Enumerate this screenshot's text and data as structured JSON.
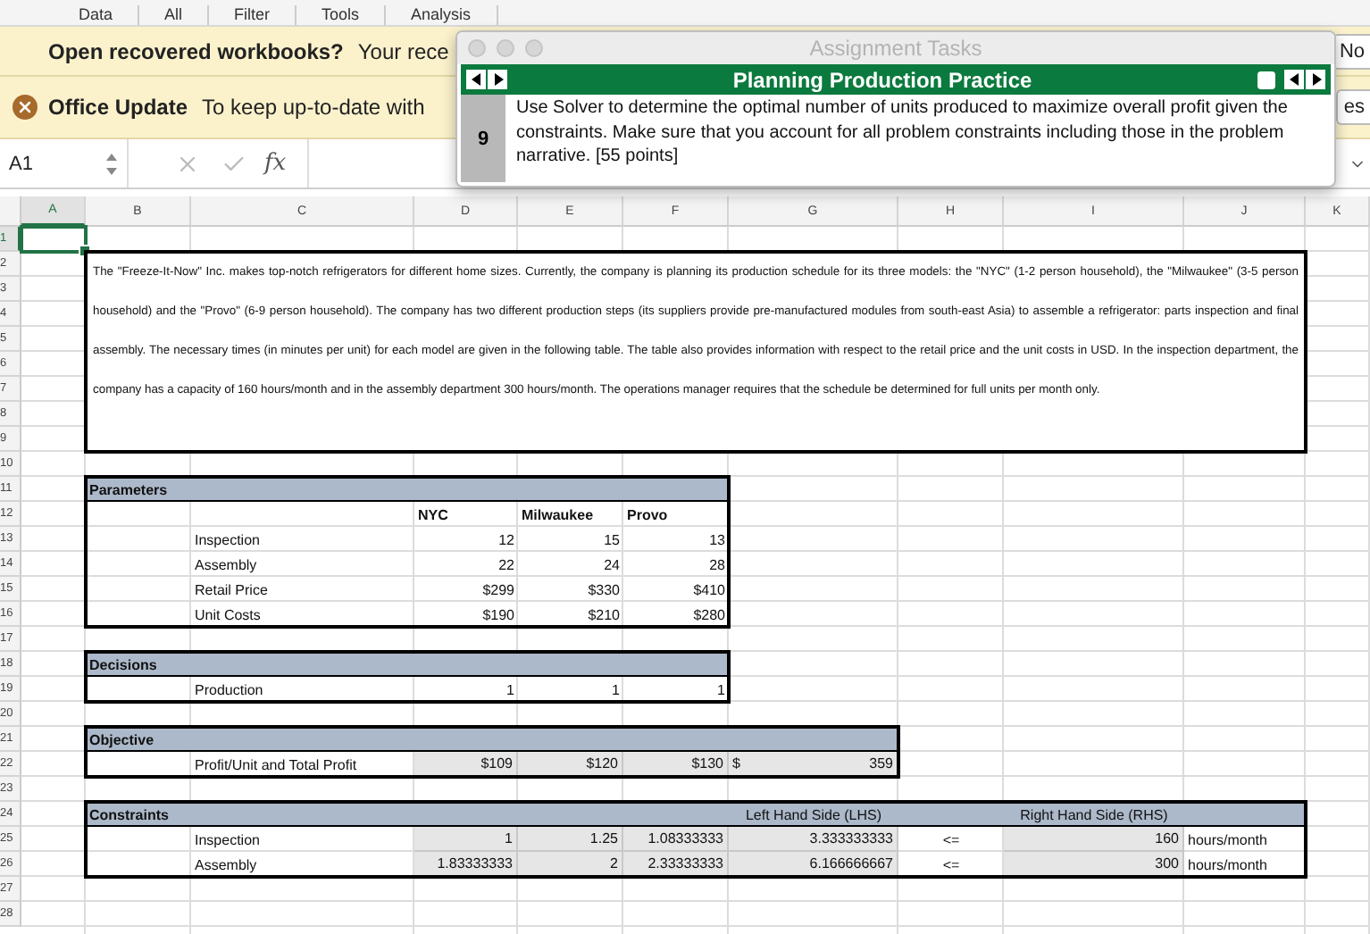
{
  "toolbar": {
    "items": [
      "Data",
      "All",
      "Filter",
      "Tools",
      "Analysis"
    ]
  },
  "notifications": [
    {
      "kind": "recovery",
      "title": "Open recovered workbooks?",
      "message": "Your rece",
      "button": "No"
    },
    {
      "kind": "update",
      "title": "Office Update",
      "message": "To keep up-to-date with",
      "button": "es"
    }
  ],
  "formula_bar": {
    "name_box": "A1",
    "function_label": "fx"
  },
  "task_pane": {
    "window_title": "Assignment Tasks",
    "header": "Planning Production Practice",
    "checked": false,
    "task_number": "9",
    "task_text": "Use Solver to determine the optimal number of units produced to maximize overall profit given the constraints. Make sure that you account for all problem constraints including those in the problem narrative. [55 points]"
  },
  "sheet": {
    "column_headers": [
      {
        "label": "A",
        "selected": true
      },
      {
        "label": "B",
        "selected": false
      },
      {
        "label": "C",
        "selected": false
      },
      {
        "label": "D",
        "selected": false
      },
      {
        "label": "E",
        "selected": false
      },
      {
        "label": "F",
        "selected": false
      },
      {
        "label": "G",
        "selected": false
      },
      {
        "label": "H",
        "selected": false
      },
      {
        "label": "I",
        "selected": false
      },
      {
        "label": "J",
        "selected": false
      },
      {
        "label": "K",
        "selected": false
      }
    ],
    "row_numbers": [
      {
        "label": "1",
        "selected": true
      },
      {
        "label": "2",
        "selected": false
      },
      {
        "label": "3",
        "selected": false
      },
      {
        "label": "4",
        "selected": false
      },
      {
        "label": "5",
        "selected": false
      },
      {
        "label": "6",
        "selected": false
      },
      {
        "label": "7",
        "selected": false
      },
      {
        "label": "8",
        "selected": false
      },
      {
        "label": "9",
        "selected": false
      },
      {
        "label": "10",
        "selected": false
      },
      {
        "label": "11",
        "selected": false
      },
      {
        "label": "12",
        "selected": false
      },
      {
        "label": "13",
        "selected": false
      },
      {
        "label": "14",
        "selected": false
      },
      {
        "label": "15",
        "selected": false
      },
      {
        "label": "16",
        "selected": false
      },
      {
        "label": "17",
        "selected": false
      },
      {
        "label": "18",
        "selected": false
      },
      {
        "label": "19",
        "selected": false
      },
      {
        "label": "20",
        "selected": false
      },
      {
        "label": "21",
        "selected": false
      },
      {
        "label": "22",
        "selected": false
      },
      {
        "label": "23",
        "selected": false
      },
      {
        "label": "24",
        "selected": false
      },
      {
        "label": "25",
        "selected": false
      },
      {
        "label": "26",
        "selected": false
      },
      {
        "label": "27",
        "selected": false
      },
      {
        "label": "28",
        "selected": false
      }
    ],
    "paragraph": "The \"Freeze-It-Now\" Inc. makes top-notch refrigerators for different home sizes. Currently, the company is planning its production schedule for its three models: the \"NYC\" (1-2 person household), the \"Milwaukee\" (3-5 person household) and the \"Provo\" (6-9 person household). The company has two different production steps (its suppliers provide pre-manufactured modules from south-east Asia) to assemble a refrigerator: parts inspection and final assembly. The necessary times (in minutes per unit) for each model are given in the following table. The table also provides information with respect to the retail price and the unit costs in USD. In the inspection department, the company has a capacity of 160 hours/month and in the assembly department 300 hours/month. The operations manager requires that the schedule be determined for full units per month only.",
    "tables": [
      {
        "title": "Parameters",
        "column_labels": [
          "NYC",
          "Milwaukee",
          "Provo"
        ],
        "rows": [
          {
            "label": "Inspection",
            "values": [
              {
                "text": "12",
                "shaded": false
              },
              {
                "text": "15",
                "shaded": false
              },
              {
                "text": "13",
                "shaded": false
              }
            ]
          },
          {
            "label": "Assembly",
            "values": [
              {
                "text": "22",
                "shaded": false
              },
              {
                "text": "24",
                "shaded": false
              },
              {
                "text": "28",
                "shaded": false
              }
            ]
          },
          {
            "label": "Retail Price",
            "values": [
              {
                "text": "$299",
                "shaded": false
              },
              {
                "text": "$330",
                "shaded": false
              },
              {
                "text": "$410",
                "shaded": false
              }
            ]
          },
          {
            "label": "Unit Costs",
            "values": [
              {
                "text": "$190",
                "shaded": false
              },
              {
                "text": "$210",
                "shaded": false
              },
              {
                "text": "$280",
                "shaded": false
              }
            ]
          }
        ]
      },
      {
        "title": "Decisions",
        "rows": [
          {
            "label": "Production",
            "values": [
              {
                "text": "1",
                "shaded": false
              },
              {
                "text": "1",
                "shaded": false
              },
              {
                "text": "1",
                "shaded": false
              }
            ]
          }
        ]
      },
      {
        "title": "Objective",
        "rows": [
          {
            "label": "Profit/Unit and Total Profit",
            "values": [
              {
                "text": "$109",
                "shaded": true
              },
              {
                "text": "$120",
                "shaded": true
              },
              {
                "text": "$130",
                "shaded": true
              },
              {
                "text": "359",
                "prefix": "$",
                "shaded": true
              }
            ]
          }
        ]
      },
      {
        "title": "Constraints",
        "headings": [
          "Left Hand Side (LHS)",
          "Right Hand Side (RHS)"
        ],
        "rows": [
          {
            "label": "Inspection",
            "values": [
              {
                "text": "1",
                "shaded": true
              },
              {
                "text": "1.25",
                "shaded": true
              },
              {
                "text": "1.08333333",
                "shaded": true
              },
              {
                "text": "3.333333333",
                "shaded": true
              },
              {
                "text": "<=",
                "shaded": false
              },
              {
                "text": "160",
                "shaded": true
              },
              {
                "text": "hours/month",
                "shaded": false
              }
            ]
          },
          {
            "label": "Assembly",
            "values": [
              {
                "text": "1.83333333",
                "shaded": true
              },
              {
                "text": "2",
                "shaded": true
              },
              {
                "text": "2.33333333",
                "shaded": true
              },
              {
                "text": "6.166666667",
                "shaded": true
              },
              {
                "text": "<=",
                "shaded": false
              },
              {
                "text": "300",
                "shaded": true
              },
              {
                "text": "hours/month",
                "shaded": false
              }
            ]
          }
        ]
      }
    ]
  }
}
